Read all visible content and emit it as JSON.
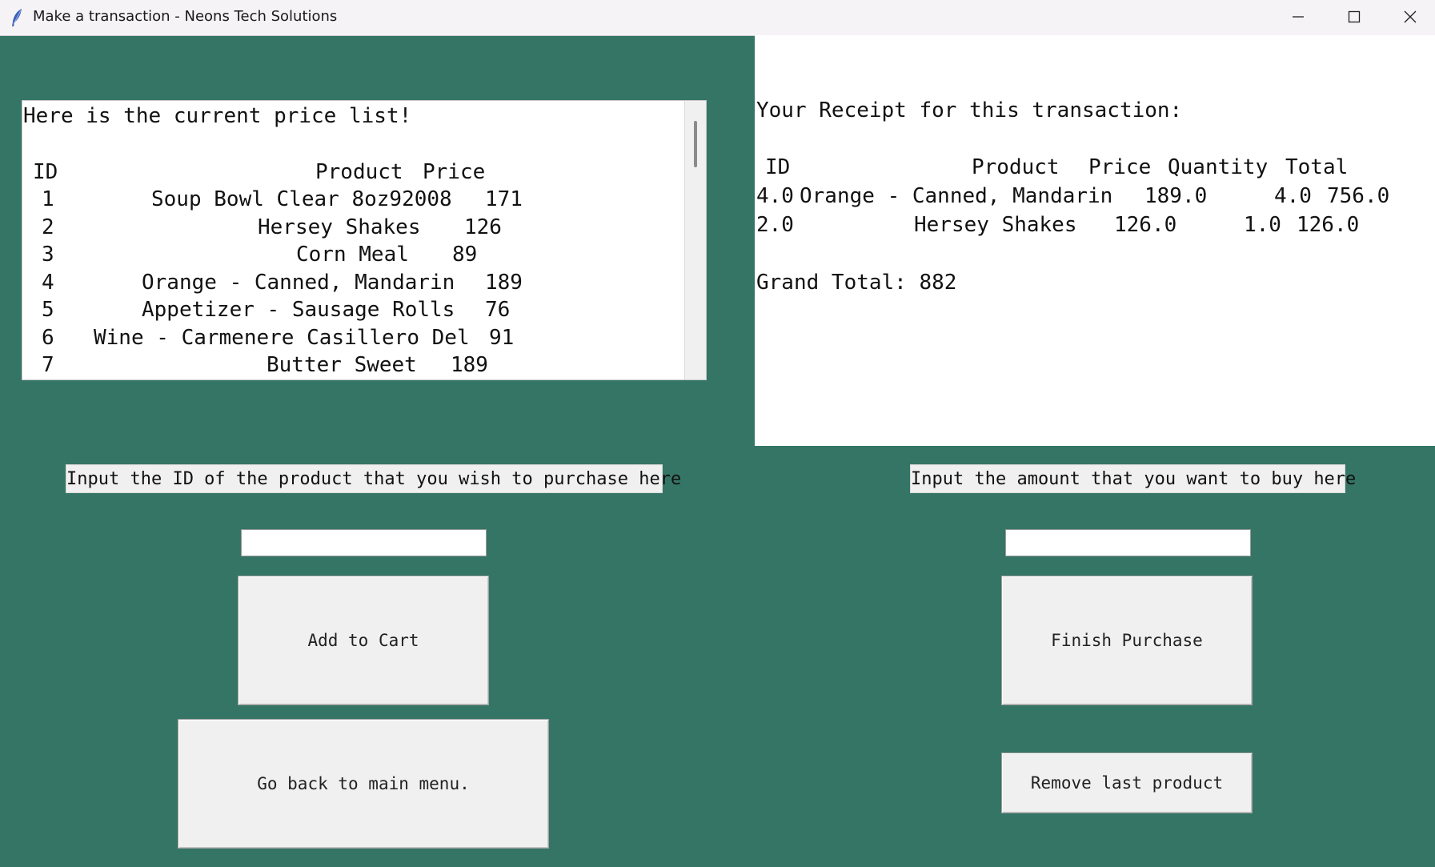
{
  "window": {
    "title": "Make a transaction - Neons Tech Solutions",
    "icon": "feather-icon"
  },
  "price_list": {
    "heading": "Here is the current price list!",
    "header": {
      "id": "ID",
      "product": "Product",
      "price": "Price"
    },
    "rows": [
      {
        "id": "1",
        "product": "Soup Bowl Clear 8oz92008",
        "price": "171"
      },
      {
        "id": "2",
        "product": "Hersey Shakes",
        "price": "126"
      },
      {
        "id": "3",
        "product": "Corn Meal",
        "price": "89"
      },
      {
        "id": "4",
        "product": "Orange - Canned, Mandarin",
        "price": "189"
      },
      {
        "id": "5",
        "product": "Appetizer - Sausage Rolls",
        "price": "76"
      },
      {
        "id": "6",
        "product": "Wine - Carmenere Casillero Del",
        "price": "91"
      },
      {
        "id": "7",
        "product": "Butter Sweet",
        "price": "189"
      }
    ]
  },
  "receipt": {
    "heading": "Your Receipt for this transaction:",
    "header": {
      "id": "ID",
      "product": "Product",
      "price": "Price",
      "quantity": "Quantity",
      "total": "Total"
    },
    "rows": [
      {
        "id": "4.0",
        "product": "Orange - Canned, Mandarin",
        "price": "189.0",
        "quantity": "4.0",
        "total": "756.0"
      },
      {
        "id": "2.0",
        "product": "Hersey Shakes",
        "price": "126.0",
        "quantity": "1.0",
        "total": "126.0"
      }
    ],
    "grand_total": "Grand Total: 882"
  },
  "left_panel": {
    "prompt": "Input the ID of the product that you wish to purchase here",
    "input_value": "",
    "add_button": "Add to Cart",
    "back_button": "Go back to main menu."
  },
  "right_panel": {
    "prompt": "Input the amount that you want to buy here",
    "input_value": "",
    "finish_button": "Finish Purchase",
    "remove_button": "Remove last product"
  },
  "colors": {
    "background": "#357565",
    "panel": "#ffffff",
    "button": "#f0f0f0"
  }
}
